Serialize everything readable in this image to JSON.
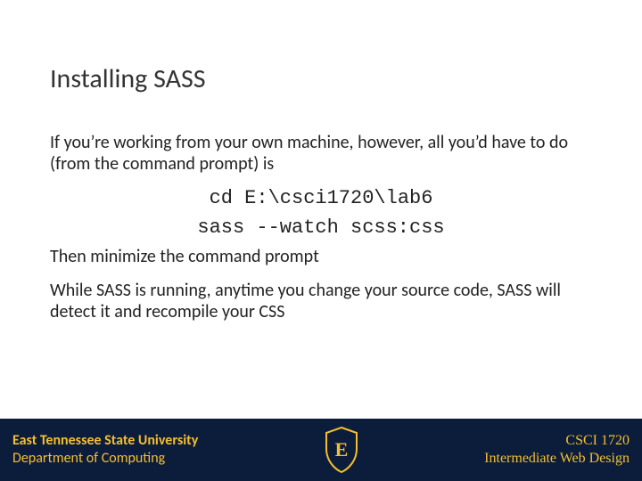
{
  "title": "Installing SASS",
  "body": {
    "p1": "If you’re working from your own machine, however, all you’d have to do (from the command prompt) is",
    "code1": "cd E:\\csci1720\\lab6",
    "code2": "sass --watch scss:css",
    "p2": "Then minimize the command prompt",
    "p3": "While SASS is running, anytime you change your source code, SASS will detect it and recompile your CSS"
  },
  "footer": {
    "left_line1": "East Tennessee State University",
    "left_line2": "Department of Computing",
    "right_line1": "CSCI 1720",
    "right_line2": "Intermediate Web Design",
    "logo_letter": "E"
  }
}
